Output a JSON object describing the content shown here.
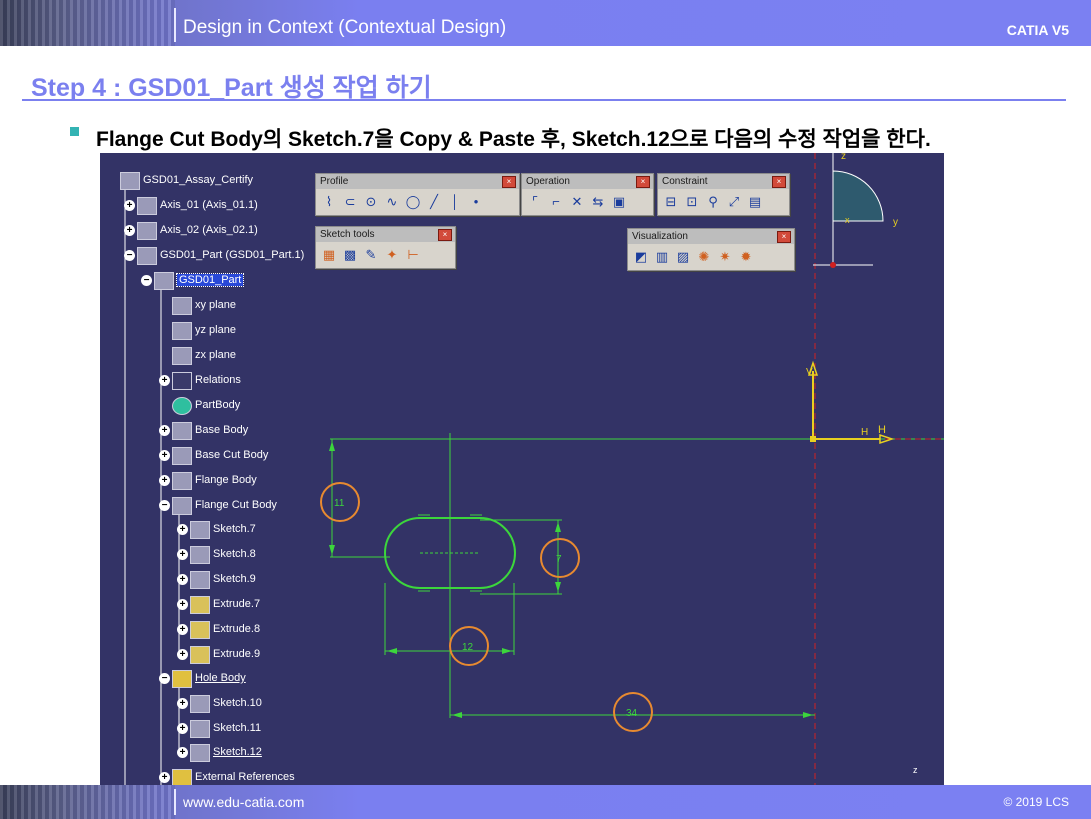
{
  "header": {
    "title": "Design in Context (Contextual Design)",
    "brand": "CATIA V5"
  },
  "step": {
    "heading": "Step 4 : GSD01_Part 생성 작업 하기"
  },
  "instruction": "Flange Cut Body의 Sketch.7을 Copy & Paste 후, Sketch.12으로 다음의 수정 작업을 한다.",
  "tree": {
    "items": [
      {
        "label": "GSD01_Assay_Certify",
        "icon": "product-icon"
      },
      {
        "label": "Axis_01 (Axis_01.1)",
        "icon": "part-icon"
      },
      {
        "label": "Axis_02 (Axis_02.1)",
        "icon": "part-icon"
      },
      {
        "label": "GSD01_Part (GSD01_Part.1)",
        "icon": "part-icon"
      },
      {
        "label": "GSD01_Part",
        "icon": "part-icon"
      },
      {
        "label": "xy plane",
        "icon": "plane-icon"
      },
      {
        "label": "yz plane",
        "icon": "plane-icon"
      },
      {
        "label": "zx plane",
        "icon": "plane-icon"
      },
      {
        "label": "Relations",
        "icon": "relations-icon"
      },
      {
        "label": "PartBody",
        "icon": "gear-icon"
      },
      {
        "label": "Base Body",
        "icon": "body-icon"
      },
      {
        "label": "Base Cut Body",
        "icon": "body-icon"
      },
      {
        "label": "Flange Body",
        "icon": "body-icon"
      },
      {
        "label": "Flange Cut Body",
        "icon": "body-icon"
      },
      {
        "label": "Sketch.7",
        "icon": "sketch-icon"
      },
      {
        "label": "Sketch.8",
        "icon": "sketch-icon"
      },
      {
        "label": "Sketch.9",
        "icon": "sketch-icon"
      },
      {
        "label": "Extrude.7",
        "icon": "extrude-icon"
      },
      {
        "label": "Extrude.8",
        "icon": "extrude-icon"
      },
      {
        "label": "Extrude.9",
        "icon": "extrude-icon"
      },
      {
        "label": "Hole Body",
        "icon": "body-icon"
      },
      {
        "label": "Sketch.10",
        "icon": "sketch-icon"
      },
      {
        "label": "Sketch.11",
        "icon": "sketch-icon"
      },
      {
        "label": "Sketch.12",
        "icon": "sketch-icon"
      },
      {
        "label": "External References",
        "icon": "external-icon"
      }
    ]
  },
  "toolbars": {
    "profile": "Profile",
    "operation": "Operation",
    "constraint": "Constraint",
    "sketch_tools": "Sketch tools",
    "visualization": "Visualization"
  },
  "sketch": {
    "dims": {
      "height": "11",
      "slot_height": "7",
      "slot_length": "12",
      "offset": "34"
    },
    "axis_h": "H",
    "axis_h2": "H",
    "axis_v": "V",
    "compass_z": "z",
    "compass_y": "y",
    "compass_x": "x",
    "corner_z": "z"
  },
  "footer": {
    "url": "www.edu-catia.com",
    "copyright": "© 2019 LCS"
  }
}
